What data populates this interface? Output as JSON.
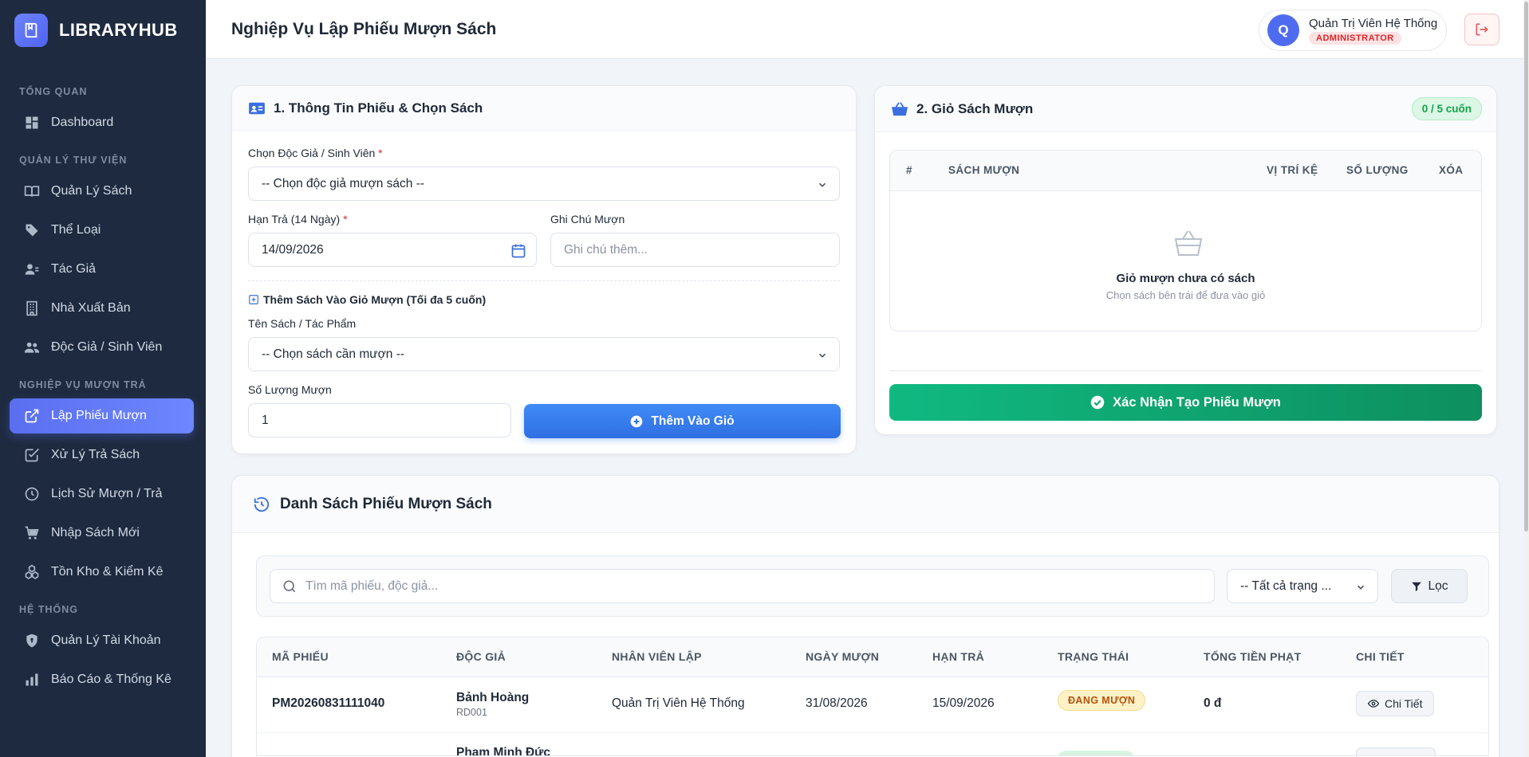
{
  "sidebar": {
    "brand": "LIBRARYHUB",
    "sections": {
      "overview": "TỔNG QUAN",
      "library": "QUẢN LÝ THƯ VIỆN",
      "loans": "NGHIỆP VỤ MƯỢN TRẢ",
      "system": "HỆ THỐNG"
    },
    "items": [
      {
        "label": "Dashboard",
        "icon": "dashboard-icon"
      },
      {
        "label": "Quản Lý Sách",
        "icon": "book-icon"
      },
      {
        "label": "Thể Loại",
        "icon": "tag-icon"
      },
      {
        "label": "Tác Giả",
        "icon": "author-icon"
      },
      {
        "label": "Nhà Xuất Bản",
        "icon": "building-icon"
      },
      {
        "label": "Độc Giả / Sinh Viên",
        "icon": "users-icon"
      },
      {
        "label": "Lập Phiếu Mượn",
        "icon": "external-link-icon",
        "active": true
      },
      {
        "label": "Xử Lý Trả Sách",
        "icon": "check-square-icon"
      },
      {
        "label": "Lịch Sử Mượn / Trả",
        "icon": "clock-icon"
      },
      {
        "label": "Nhập Sách Mới",
        "icon": "cart-icon"
      },
      {
        "label": "Tồn Kho & Kiểm Kê",
        "icon": "boxes-icon"
      },
      {
        "label": "Quản Lý Tài Khoản",
        "icon": "shield-icon"
      },
      {
        "label": "Báo Cáo & Thống Kê",
        "icon": "bar-chart-icon"
      }
    ]
  },
  "header": {
    "title": "Nghiệp Vụ Lập Phiếu Mượn Sách",
    "user_initial": "Q",
    "user_name": "Quản Trị Viên Hệ Thống",
    "user_role": "ADMINISTRATOR"
  },
  "form": {
    "title": "1. Thông Tin Phiếu & Chọn Sách",
    "reader_label": "Chọn Độc Giả / Sinh Viên",
    "reader_placeholder": "-- Chọn độc giả mượn sách --",
    "due_label": "Hạn Trả (14 Ngày)",
    "due_value": "14/09/2026",
    "note_label": "Ghi Chú Mượn",
    "note_placeholder": "Ghi chú thêm...",
    "add_section_title": "Thêm Sách Vào Giỏ Mượn (Tối đa 5 cuốn)",
    "book_label": "Tên Sách / Tác Phẩm",
    "book_placeholder": "-- Chọn sách cần mượn --",
    "qty_label": "Số Lượng Mượn",
    "qty_value": "1",
    "add_button": "Thêm Vào Giỏ",
    "required_mark": "*"
  },
  "cart": {
    "title": "2. Giỏ Sách Mượn",
    "count_badge": "0 / 5 cuốn",
    "columns": [
      "#",
      "SÁCH MƯỢN",
      "VỊ TRÍ KỆ",
      "SỐ LƯỢNG",
      "XÓA"
    ],
    "empty_title": "Giỏ mượn chưa có sách",
    "empty_sub": "Chọn sách bên trái để đưa vào giỏ",
    "confirm_button": "Xác Nhận Tạo Phiếu Mượn"
  },
  "loans": {
    "title": "Danh Sách Phiếu Mượn Sách",
    "search_placeholder": "Tìm mã phiếu, độc giả...",
    "status_selected": "-- Tất cả trạng ...",
    "filter_button": "Lọc",
    "columns": [
      "MÃ PHIẾU",
      "ĐỘC GIẢ",
      "NHÂN VIÊN LẬP",
      "NGÀY MƯỢN",
      "HẠN TRẢ",
      "TRẠNG THÁI",
      "TỔNG TIỀN PHẠT",
      "CHI TIẾT"
    ],
    "rows": [
      {
        "code": "PM20260831111040",
        "reader": "Bảnh Hoàng",
        "reader_id": "RD001",
        "staff": "Quản Trị Viên Hệ Thống",
        "borrow_date": "31/08/2026",
        "due_date": "15/09/2026",
        "status": "ĐANG MƯỢN",
        "fine": "0 đ",
        "detail": "Chi Tiết"
      },
      {
        "reader": "Phạm Minh Đức"
      }
    ]
  },
  "colors": {
    "sidebar_bg": "#1e2a3f",
    "accent": "#5a6ff0",
    "primary": "#2f6fe3",
    "success": "#10b981",
    "danger": "#dc2626"
  }
}
